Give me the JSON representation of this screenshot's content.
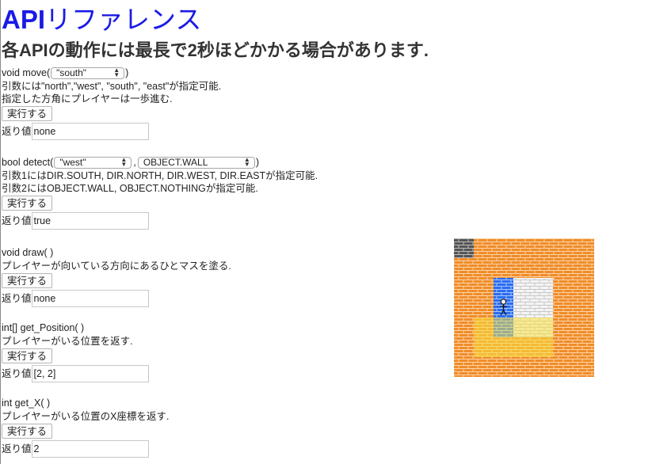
{
  "title_api": "API",
  "title_rest": "リファレンス",
  "subtitle": "各APIの動作には最長で2秒ほどかかる場合があります.",
  "move": {
    "sig_prefix": "void move(",
    "sig_suffix": ")",
    "select_value": "\"south\"",
    "desc1": "引数には\"north\",\"west\", \"south\", \"east\"が指定可能.",
    "desc2": "指定した方角にプレイヤーは一歩進む.",
    "button": "実行する",
    "ret_label": "返り値",
    "ret_value": "none"
  },
  "detect": {
    "sig_prefix": "bool detect(",
    "comma": ",",
    "sig_suffix": ")",
    "select1_value": "\"west\"",
    "select2_value": "OBJECT.WALL",
    "desc1": "引数1にはDIR.SOUTH, DIR.NORTH, DIR.WEST, DIR.EASTが指定可能.",
    "desc2": "引数2にはOBJECT.WALL, OBJECT.NOTHINGが指定可能.",
    "button": "実行する",
    "ret_label": "返り値",
    "ret_value": "true"
  },
  "draw": {
    "sig": "void draw( )",
    "desc1": "プレイヤーが向いている方向にあるひとマスを塗る.",
    "button": "実行する",
    "ret_label": "返り値",
    "ret_value": "none"
  },
  "getpos": {
    "sig": "int[] get_Position( )",
    "desc1": "プレイヤーがいる位置を返す.",
    "button": "実行する",
    "ret_label": "返り値",
    "ret_value": "[2, 2]"
  },
  "getx": {
    "sig": "int get_X( )",
    "desc1": "プレイヤーがいる位置のX座標を返す.",
    "button": "実行する",
    "ret_label": "返り値",
    "ret_value": "2"
  },
  "colors": {
    "title": "#1a1ae6",
    "brick_orange": "#f08c28",
    "brick_blue": "#2a6ef0",
    "brick_white": "#f4f4f4",
    "brick_gray": "#555555",
    "highlight_yellow": "#f8e040"
  }
}
